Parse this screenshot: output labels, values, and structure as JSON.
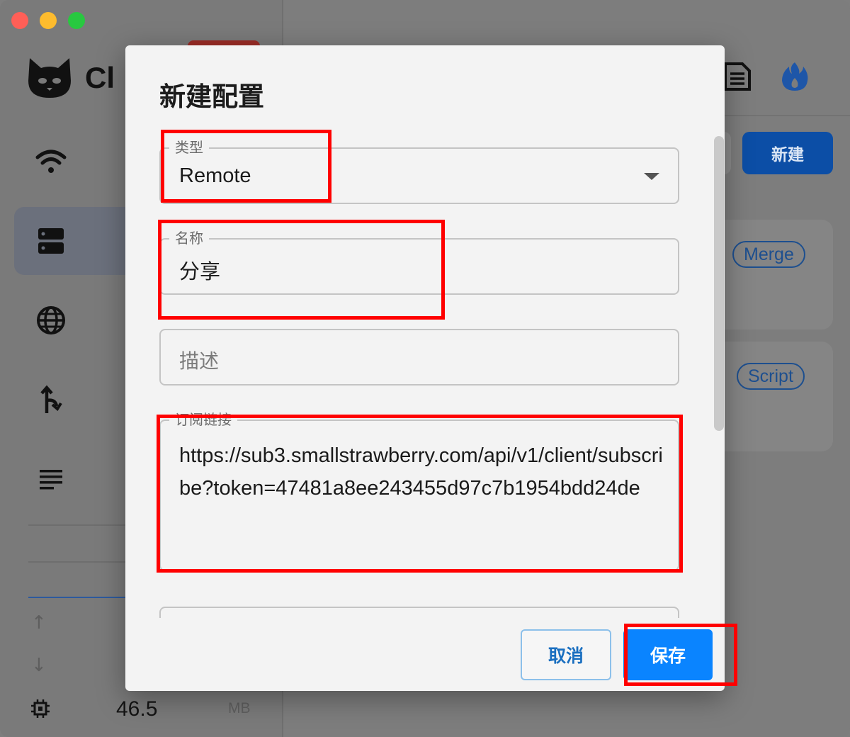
{
  "app": {
    "brand_text": "Cl",
    "memory_value": "46.5",
    "memory_unit": "MB",
    "new_button_label": "新建",
    "chips": [
      "Merge",
      "Script"
    ]
  },
  "dialog": {
    "title": "新建配置",
    "fields": {
      "type": {
        "label": "类型",
        "value": "Remote"
      },
      "name": {
        "label": "名称",
        "value": "分享"
      },
      "desc": {
        "placeholder": "描述"
      },
      "url": {
        "label": "订阅链接",
        "value": "https://sub3.smallstrawberry.com/api/v1/client/subscribe?token=47481a8ee243455d97c7b1954bdd24de"
      }
    },
    "cancel_label": "取消",
    "save_label": "保存"
  },
  "colors": {
    "primary": "#0a84ff",
    "highlight": "#ff0000",
    "new_button": "#0c4ea6"
  },
  "icons": [
    "cat-logo-icon",
    "wifi-icon",
    "server-icon",
    "globe-icon",
    "route-icon",
    "list-icon",
    "arrow-up-icon",
    "arrow-down-icon",
    "chip-icon",
    "document-icon",
    "flame-icon",
    "chevron-down-icon"
  ]
}
